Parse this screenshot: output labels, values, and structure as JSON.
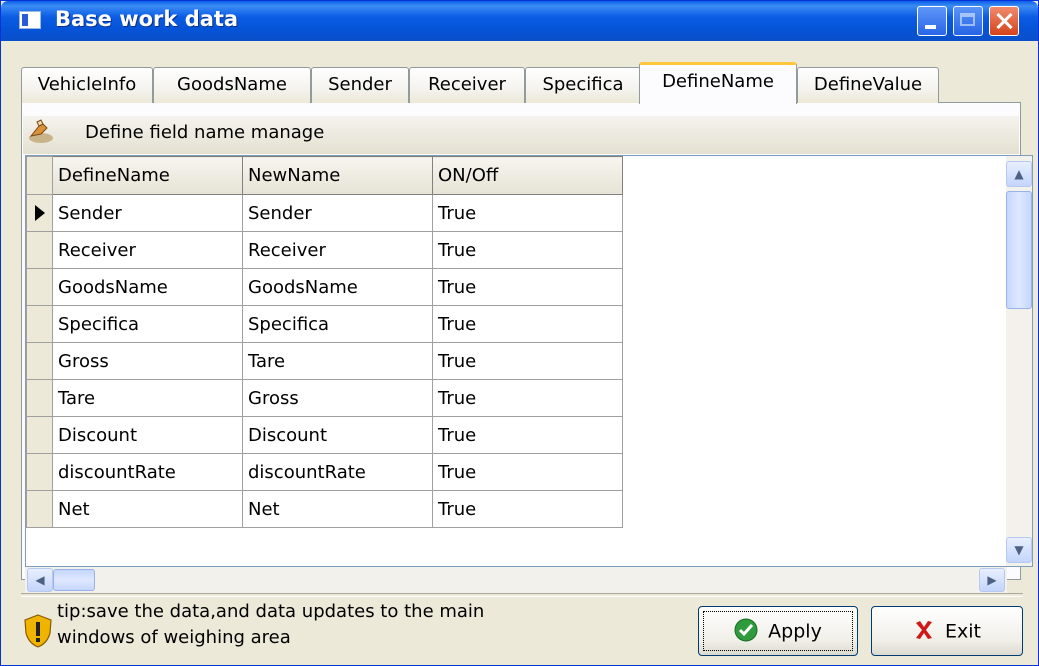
{
  "window": {
    "title": "Base work data"
  },
  "tabs": [
    {
      "label": "VehicleInfo"
    },
    {
      "label": "GoodsName"
    },
    {
      "label": "Sender"
    },
    {
      "label": "Receiver"
    },
    {
      "label": "Specifica"
    },
    {
      "label": "DefineName",
      "active": true
    },
    {
      "label": "DefineValue"
    }
  ],
  "panel": {
    "header": "Define field name manage"
  },
  "grid": {
    "columns": [
      "DefineName",
      "NewName",
      "ON/Off"
    ],
    "rows": [
      [
        "Sender",
        "Sender",
        "True"
      ],
      [
        "Receiver",
        "Receiver",
        "True"
      ],
      [
        "GoodsName",
        "GoodsName",
        "True"
      ],
      [
        "Specifica",
        "Specifica",
        "True"
      ],
      [
        "Gross",
        "Tare",
        "True"
      ],
      [
        "Tare",
        "Gross",
        "True"
      ],
      [
        "Discount",
        "Discount",
        "True"
      ],
      [
        "discountRate",
        "discountRate",
        "True"
      ],
      [
        "Net",
        "Net",
        "True"
      ]
    ]
  },
  "footer": {
    "tip": "tip:save the data,and data updates to the main windows of weighing area",
    "apply_label": "Apply",
    "exit_label": "Exit"
  },
  "icons": {
    "window": "window-icon",
    "header": "edit-hand-icon",
    "tip": "warning-shield-icon",
    "apply": "green-check-icon",
    "exit": "red-x-icon"
  }
}
